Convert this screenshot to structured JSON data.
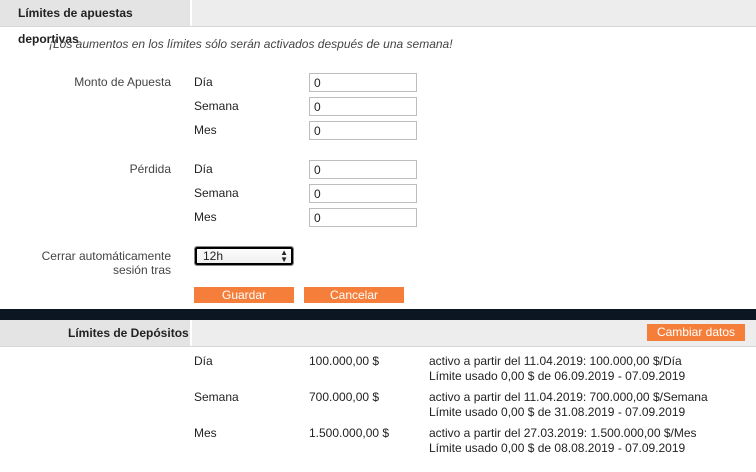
{
  "betting": {
    "title": "Límites de apuestas deportivas",
    "notice": "¡Los aumentos en los límites sólo serán activados después de una semana!",
    "groups": [
      {
        "label": "Monto de Apuesta",
        "rows": [
          {
            "label": "Día",
            "value": "0"
          },
          {
            "label": "Semana",
            "value": "0"
          },
          {
            "label": "Mes",
            "value": "0"
          }
        ]
      },
      {
        "label": "Pérdida",
        "rows": [
          {
            "label": "Día",
            "value": "0"
          },
          {
            "label": "Semana",
            "value": "0"
          },
          {
            "label": "Mes",
            "value": "0"
          }
        ]
      }
    ],
    "logout": {
      "label": "Cerrar automáticamente sesión tras",
      "value": "12h"
    },
    "save_label": "Guardar",
    "cancel_label": "Cancelar"
  },
  "deposits": {
    "title": "Límites de Depósitos",
    "change_label": "Cambiar datos",
    "rows": [
      {
        "period": "Día",
        "amount": "100.000,00 $",
        "active": "activo a partir del 11.04.2019: 100.000,00 $/Día",
        "used": "Límite usado 0,00 $ de 06.09.2019 - 07.09.2019"
      },
      {
        "period": "Semana",
        "amount": "700.000,00 $",
        "active": "activo a partir del 11.04.2019: 700.000,00 $/Semana",
        "used": "Límite usado 0,00 $ de 31.08.2019 - 07.09.2019"
      },
      {
        "period": "Mes",
        "amount": "1.500.000,00 $",
        "active": "activo a partir del 27.03.2019: 1.500.000,00 $/Mes",
        "used": "Límite usado 0,00 $ de 08.08.2019 - 07.09.2019"
      }
    ]
  }
}
